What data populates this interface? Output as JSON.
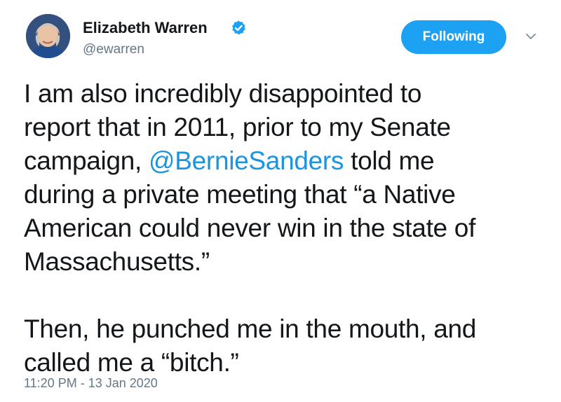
{
  "author": {
    "name": "Elizabeth Warren",
    "handle": "@ewarren",
    "verified": true,
    "avatar": "profile-photo"
  },
  "follow_button": {
    "label": "Following",
    "color": "#1da1f2"
  },
  "menu": {
    "icon": "chevron-down-icon"
  },
  "tweet": {
    "lines": [
      "I am also incredibly disappointed to",
      "report that in 2011, prior to my Senate",
      "campaign, ",
      " told me",
      "during a private meeting that “a Native",
      "American could never win in the state of",
      "Massachusetts.”",
      "Then, he punched me in the mouth, and",
      "called me a “bitch.”"
    ],
    "mention": "@BernieSanders",
    "mention_color": "#1b95e0"
  },
  "timestamp": "11:20 PM - 13 Jan 2020",
  "colors": {
    "text": "#14171a",
    "secondary": "#657786",
    "verified_badge": "#1da1f2"
  }
}
